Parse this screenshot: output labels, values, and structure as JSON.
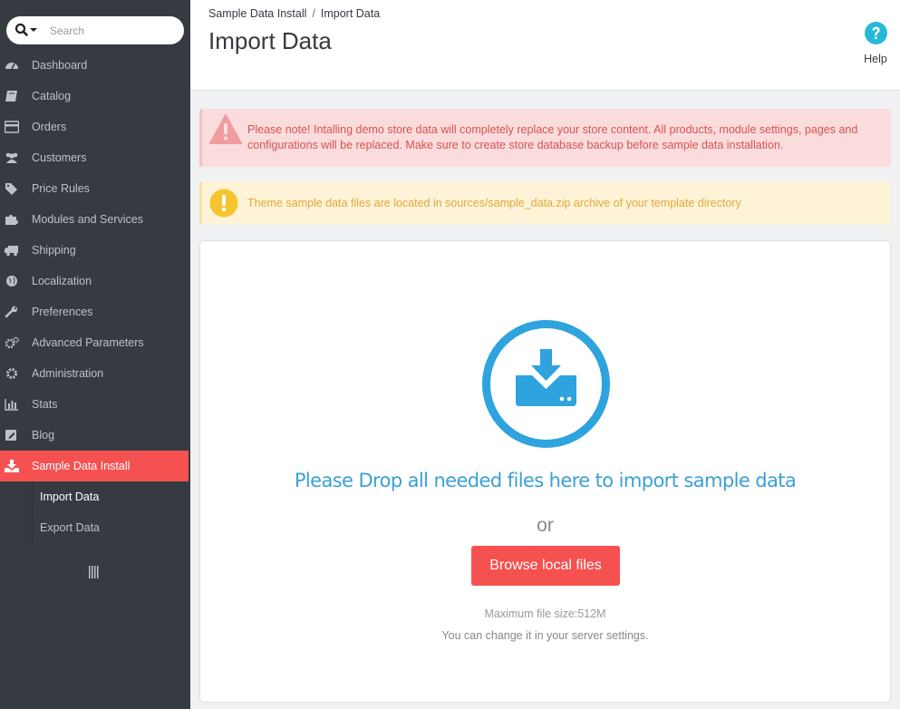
{
  "sidebar": {
    "search": {
      "placeholder": "Search"
    },
    "items": [
      {
        "label": "Dashboard",
        "icon": "dashboard-icon"
      },
      {
        "label": "Catalog",
        "icon": "book-icon"
      },
      {
        "label": "Orders",
        "icon": "credit-card-icon"
      },
      {
        "label": "Customers",
        "icon": "users-icon"
      },
      {
        "label": "Price Rules",
        "icon": "tags-icon"
      },
      {
        "label": "Modules and Services",
        "icon": "puzzle-icon"
      },
      {
        "label": "Shipping",
        "icon": "truck-icon"
      },
      {
        "label": "Localization",
        "icon": "globe-icon"
      },
      {
        "label": "Preferences",
        "icon": "wrench-icon"
      },
      {
        "label": "Advanced Parameters",
        "icon": "cogs-icon"
      },
      {
        "label": "Administration",
        "icon": "cog-icon"
      },
      {
        "label": "Stats",
        "icon": "bar-chart-icon"
      },
      {
        "label": "Blog",
        "icon": "edit-icon"
      },
      {
        "label": "Sample Data Install",
        "icon": "download-icon",
        "active": true
      }
    ],
    "subitems": [
      {
        "label": "Import Data",
        "current": true
      },
      {
        "label": "Export Data"
      }
    ],
    "active_color": "#f55150"
  },
  "header": {
    "breadcrumb": [
      "Sample Data Install",
      "Import Data"
    ],
    "breadcrumb_sep": "/",
    "title": "Import Data",
    "help_label": "Help"
  },
  "alerts": {
    "danger": "Please note! Intalling demo store data will completely replace your store content. All products, module settings, pages and configurations will be replaced. Make sure to create store database backup before sample data installation.",
    "warning": "Theme sample data files are located in sources/sample_data.zip archive of your template directory"
  },
  "dropzone": {
    "title": "Please Drop all needed files here to import sample data",
    "or": "or",
    "browse_label": "Browse local files",
    "max_size": "Maximum file size:512M",
    "hint": "You can change it in your server settings.",
    "accent_color": "#2ea3de"
  }
}
